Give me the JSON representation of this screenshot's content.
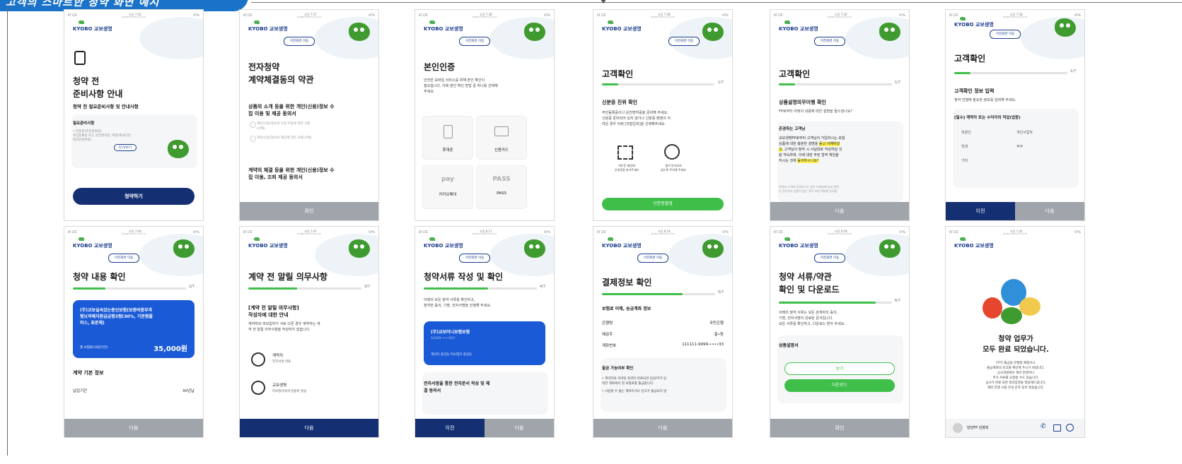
{
  "banner": "고객의 스마트한 청약 화면 예시",
  "common": {
    "carrier": "KT LTE",
    "battery": "97%",
    "url": "kyobo.derinno.co.kr",
    "logo": "KYOBO 교보생명",
    "back_pill": "이전화면 이동"
  },
  "screens": [
    {
      "time": "오후 7:35",
      "title": "청약 전\n준비사항 안내",
      "subtitle": "청약 전 필요준비사항 및 안내사항",
      "card_title": "필요준비사항",
      "card_text": "• 신분증(주민등록증)\n  주민등록증 또는 운전면허증, 여권(외국인은\n  외국인등록증)",
      "card_link": "닫기/보기",
      "cta": "청약하기"
    },
    {
      "time": "오후 7:37",
      "title": "전자청약\n계약체결동의 약관",
      "section1": "상품의 소개 등을 위한 개인(신용)정보 수\n집 이용 및 제공 동의서",
      "check1": "개인(신용)정보의 수집·이용에 관한 사항\n(선택)",
      "check2": "개인(신용)정보의 제공에 관한 사항(선택)",
      "section2": "계약의 체결 등을 위한 개인(신용)정보 수\n집 이용, 조회 제공 동의서",
      "button": "확인"
    },
    {
      "time": "오후 7:38",
      "title": "본인인증",
      "desc": "안전한 모바일 서비스를 위해 본인 확인이\n필요합니다. 아래 본인 확인 방법 중 하나를 선택해\n주세요.",
      "options": [
        "휴대폰",
        "신용카드",
        "카카오페이",
        "PASS"
      ],
      "pay_logo": "pay",
      "pass_logo": "PASS"
    },
    {
      "time": "오후 7:38",
      "title": "고객확인",
      "step": "1/7",
      "section": "신분증 진위 확인",
      "desc": "주민등록증이나 운전면허증을 준비해 주세요.\n신분증 준비되어 있지 않거나 신분증 촬영이 어\n려운 경우 아래 [직접입력]을 선택해주세요.",
      "icon1_label": "여두운 배경에\n신분증을 놓아주세요",
      "icon2_label": "빛이 반사되지\n않도록 주의해 주세요",
      "button": "신분증촬영"
    },
    {
      "time": "오후 7:30",
      "title": "고객확인",
      "step": "1/7",
      "section": "상품설명의무이행 확인",
      "desc": "FP로부터 아래의 내용에 대한 설명을 들으셨나요?",
      "card_title": "존경하는 고객님",
      "card_text_a": "교보생명FP로부터 고객님이 가입하시는 보험\n상품에 대한 충분한 설명을 ",
      "card_text_hl": "듣고 이해하셨\n고",
      "card_text_b": ", 고객님이 청약 시 사실대로 작성하실 것\n을 약속하며, 이에 대한 주된 법적 책임을\n지시는 것에 ",
      "card_text_hl2": "동의하시나요?",
      "card_foot": "보험료 고객의 동의하시는 경우 보험판매 등과 관련\n된 업무처리 방법이 맞는 경우 보험 계약을 유지할",
      "button": "다음"
    },
    {
      "time": "오후 7:38",
      "title": "고객확인",
      "step": "1/7",
      "section": "고객확인 정보 입력",
      "desc": "청약 진행에 필요한 정보를 입력해 주세요.",
      "card_title": "[필수] 계약자 또는 수익자의 직업(업종)",
      "options": [
        "직장인",
        "개인사업자",
        "학생",
        "주부",
        "기타"
      ],
      "prev": "이전",
      "next": "다음"
    },
    {
      "time": "오후 7:40",
      "title": "청약 내용 확인",
      "step": "2/7",
      "product": "(무)교보실속있는종신보험(보증비용부과\n형)(저해지환급금형3형(30%, 기본형플\n러스, 표준체)",
      "premium_label": "월 보험료(10년기간)",
      "premium": "35,000원",
      "section": "계약 기본 정보",
      "row1_label": "납입기간",
      "row1_value": "30년납",
      "button": "다음"
    },
    {
      "time": "오후 7:41",
      "title": "계약 전 알릴 의무사항",
      "step": "3/7",
      "section": "[계약 전 알릴 의무사항]\n작성자에 대한 안내",
      "desc": "계약자와 피보험자가 서로 다른 경우 계약자는 계\n약 전 알릴 의무사항을 작성하지 않습니다.",
      "p1_role": "계약자",
      "p1_desc": "전자서명 완료",
      "p2_role": "교보생명",
      "p2_desc": "피보험자에게 알림톡 발송",
      "button": "다음"
    },
    {
      "time": "오후 6:17",
      "title": "청약서류 작성 및 확인",
      "step": "4/7",
      "desc": "아래의 모든 청약 서류를 확인하고,\n청약한 동의, 기명, 전자서명을 진행해 주세요.",
      "product": "(무)교보미니보험보험",
      "product_no": "12345-•••-012",
      "product_meta": "계약자 홍길동   피보험자 홍길동",
      "card_section": "전자서명을 통한 전자문서 작성 및 체\n결 동의서",
      "prev": "이전",
      "next": "다음"
    },
    {
      "time": "오후 6:14",
      "title": "결제정보 확인",
      "step": "5/7",
      "section": "보험료 이체, 송금계좌 정보",
      "rows": [
        [
          "은행명",
          "국민은행"
        ],
        [
          "예금주",
          "홍•동"
        ],
        [
          "계좌번호",
          "111111-9999-••••33"
        ]
      ],
      "card_title": "출금 가능여부 확인",
      "card_text": "• 계약자의 모바일 청약이 완료되면 담당FP가 입\n  력한 계좌에서 첫 보험료를 출금합니다.",
      "card_text2": "• 사용할 수 없는 계좌이거나 잔고가 출금되지 않",
      "button": "다음"
    },
    {
      "time": "오후 6:18",
      "title": "청약 서류/약관\n확인 및 다운로드",
      "step": "6/7",
      "desc": "아래의 청약 서류는 모든 관계자의 동의,\n기명, 전자서명이 완료된 문서입니다.\n모든 서류를 확인하고, 다운로드 받아 주세요.",
      "card_title": "상품설명서",
      "view": "보기",
      "download": "다운로드",
      "button": "확인"
    },
    {
      "time": "오후 7:42",
      "title": "청약 업무가\n모두 완료 되었습니다.",
      "desc": "FP가 출금을 진행할 예정이니\n출금계좌의 잔고를 확인해 주시기 바랍니다.\n심사과정에서 계약 변경이나\n추가 서류를 요청할 수도 있습니다.\n심사가 완료 되면 청약증권을 발송해드립니다.\n계약 진행 사항 안내 문자 등이 발송됩니다.",
      "fp_label": "담당FP 김영희"
    }
  ]
}
